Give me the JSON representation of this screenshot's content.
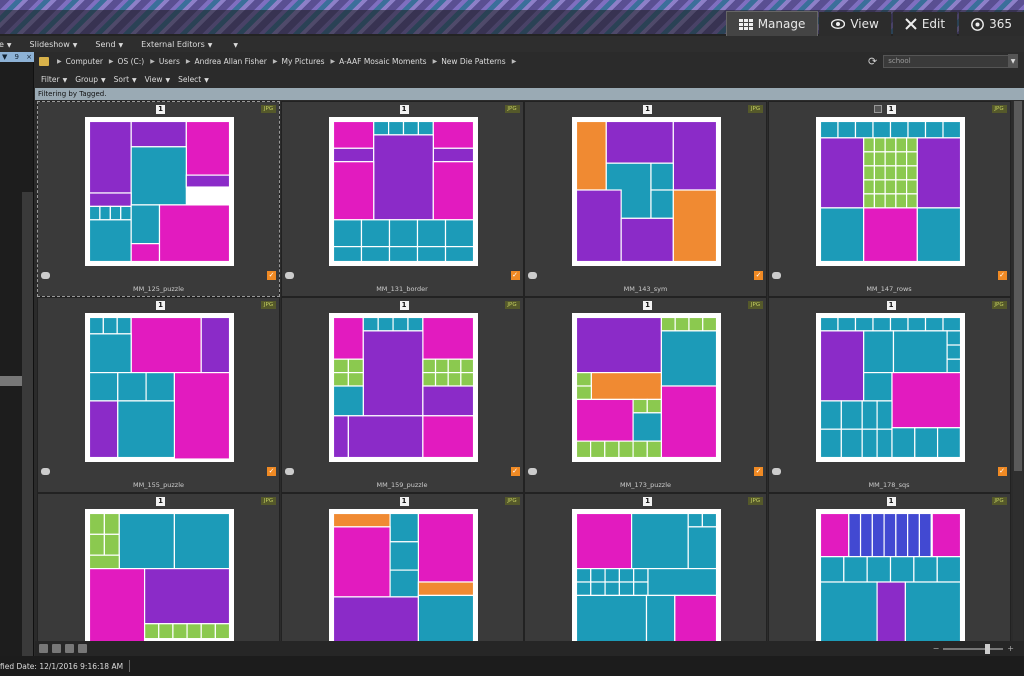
{
  "topnav": [
    {
      "label": "Manage",
      "icon": "grid-icon",
      "active": true
    },
    {
      "label": "View",
      "icon": "eye-icon",
      "active": false
    },
    {
      "label": "Edit",
      "icon": "tools-icon",
      "active": false
    },
    {
      "label": "365",
      "icon": "acdsee-365-icon",
      "active": false
    }
  ],
  "menubar": [
    "Slideshow",
    "Send",
    "External Editors"
  ],
  "left_panel": {
    "tab_label": "9",
    "close": "×"
  },
  "breadcrumb": [
    "Computer",
    "OS (C:)",
    "Users",
    "Andrea Allan Fisher",
    "My Pictures",
    "A-AAF Mosaic Moments",
    "New Die Patterns"
  ],
  "search": {
    "value": "school"
  },
  "toolbar": [
    "Filter",
    "Group",
    "Sort",
    "View",
    "Select"
  ],
  "filter_text": "Filtering by Tagged.",
  "badge_number": "1",
  "file_type": "JPG",
  "colors": {
    "purple": "#8b2bc8",
    "magenta": "#e21bbf",
    "teal": "#1c9bb8",
    "orange": "#f08a32",
    "green": "#8bc94f",
    "blue": "#4249d2"
  },
  "thumbnails": [
    {
      "name": "MM_125_puzzle"
    },
    {
      "name": "MM_131_border"
    },
    {
      "name": "MM_143_sym"
    },
    {
      "name": "MM_147_rows"
    },
    {
      "name": "MM_155_puzzle"
    },
    {
      "name": "MM_159_puzzle"
    },
    {
      "name": "MM_173_puzzle"
    },
    {
      "name": "MM_178_sqs"
    },
    {
      "name": ""
    },
    {
      "name": ""
    },
    {
      "name": ""
    },
    {
      "name": ""
    }
  ],
  "status": {
    "text": "fied Date: 12/1/2016 9:16:18 AM"
  },
  "zoom": {
    "minus": "−",
    "plus": "+",
    "level": 0.75
  }
}
